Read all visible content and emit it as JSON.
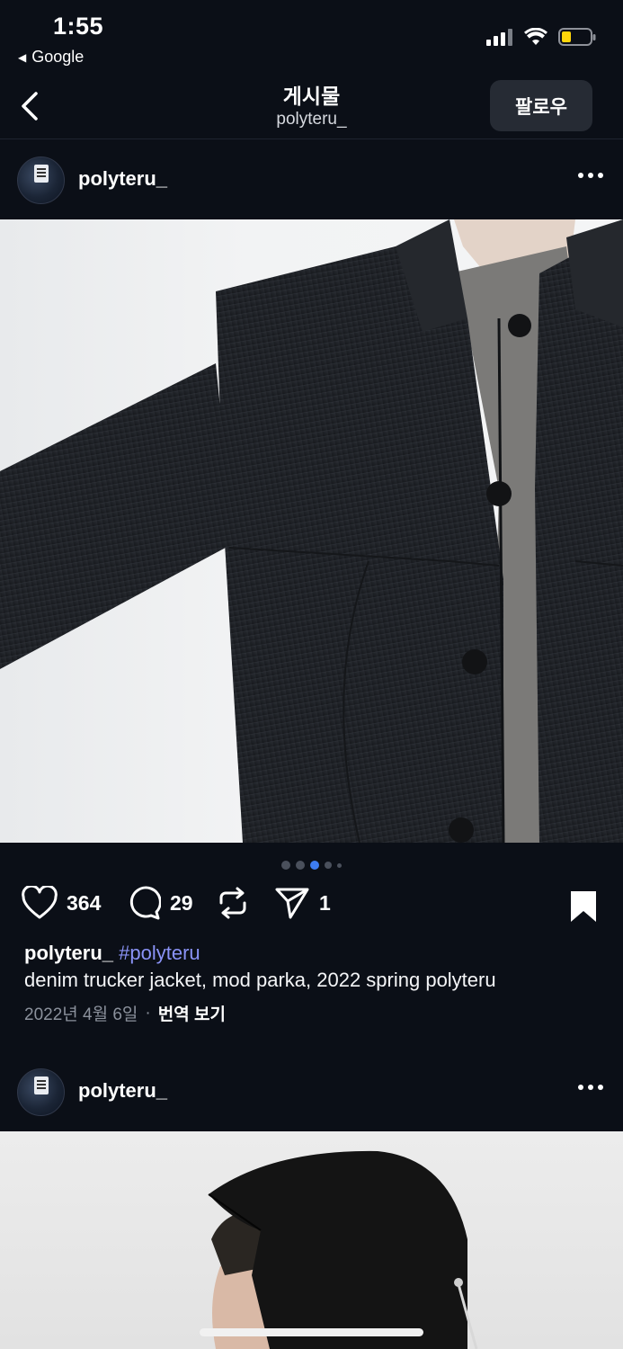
{
  "status": {
    "time": "1:55",
    "back_app": "Google"
  },
  "header": {
    "title": "게시물",
    "subtitle": "polyteru_",
    "follow_label": "팔로우"
  },
  "posts": [
    {
      "username": "polyteru_",
      "likes": "364",
      "comments": "29",
      "shares": "1",
      "caption_user": "polyteru_",
      "caption_tag": "#polyteru",
      "caption_text": "denim trucker jacket, mod parka, 2022 spring polyteru",
      "date": "2022년 4월 6일",
      "separator": "·",
      "translate_label": "번역 보기",
      "carousel": {
        "count": 5,
        "active_index": 2
      }
    },
    {
      "username": "polyteru_"
    }
  ],
  "colors": {
    "background": "#0b0f17",
    "accent_blue": "#3d7cf2",
    "hashtag": "#8a93f7",
    "battery": "#ffd60a"
  }
}
